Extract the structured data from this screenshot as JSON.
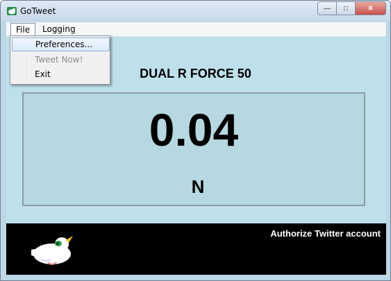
{
  "window": {
    "title": "GoTweet"
  },
  "menu": {
    "file": "File",
    "logging": "Logging"
  },
  "file_menu": {
    "preferences": "Preferences...",
    "tweet_now": "Tweet Now!",
    "exit": "Exit"
  },
  "device": {
    "name": "DUAL R FORCE 50"
  },
  "reading": {
    "value": "0.04",
    "unit": "N"
  },
  "footer": {
    "authorize_label": "Authorize Twitter account"
  }
}
